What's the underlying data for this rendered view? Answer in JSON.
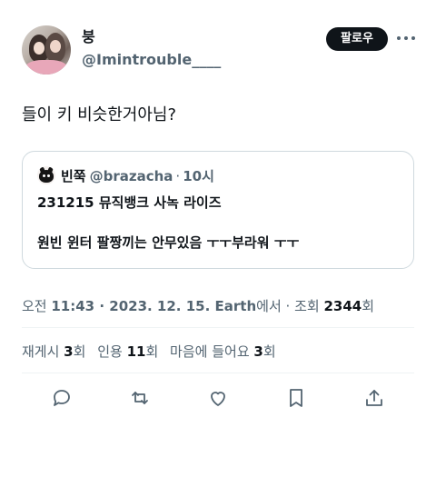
{
  "author": {
    "display_name": "붕",
    "handle": "@Imintrouble____"
  },
  "follow_label": "팔로우",
  "tweet_text": "들이 키 비슷한거아님?",
  "quote": {
    "name": "빈쭉",
    "handle": "@brazacha",
    "separator": "·",
    "time": "10시",
    "line1": "231215 뮤직뱅크 사녹 라이즈",
    "line2": "원빈 윈터 팔짱끼는 안무있음 ㅜㅜ부라워 ㅜㅜ"
  },
  "meta": {
    "prefix": "오전 ",
    "time_date": "11:43 · 2023. 12. 15.",
    "source": " Earth",
    "source_suffix": "에서",
    "sep": " · ",
    "views_label": "조회 ",
    "views": "2344",
    "views_suffix": "회"
  },
  "stats": {
    "retweets_label": "재게시 ",
    "retweets": "3",
    "retweets_suffix": "회",
    "quotes_label": "인용 ",
    "quotes": "11",
    "quotes_suffix": "회",
    "likes_label": "마음에 들어요 ",
    "likes": "3",
    "likes_suffix": "회"
  },
  "colors": {
    "text": "#0f1419",
    "secondary": "#536471",
    "border": "#cfd9de",
    "button": "#0f1419"
  },
  "icons": [
    "reply-icon",
    "retweet-icon",
    "like-icon",
    "bookmark-icon",
    "share-icon",
    "more-icon"
  ]
}
